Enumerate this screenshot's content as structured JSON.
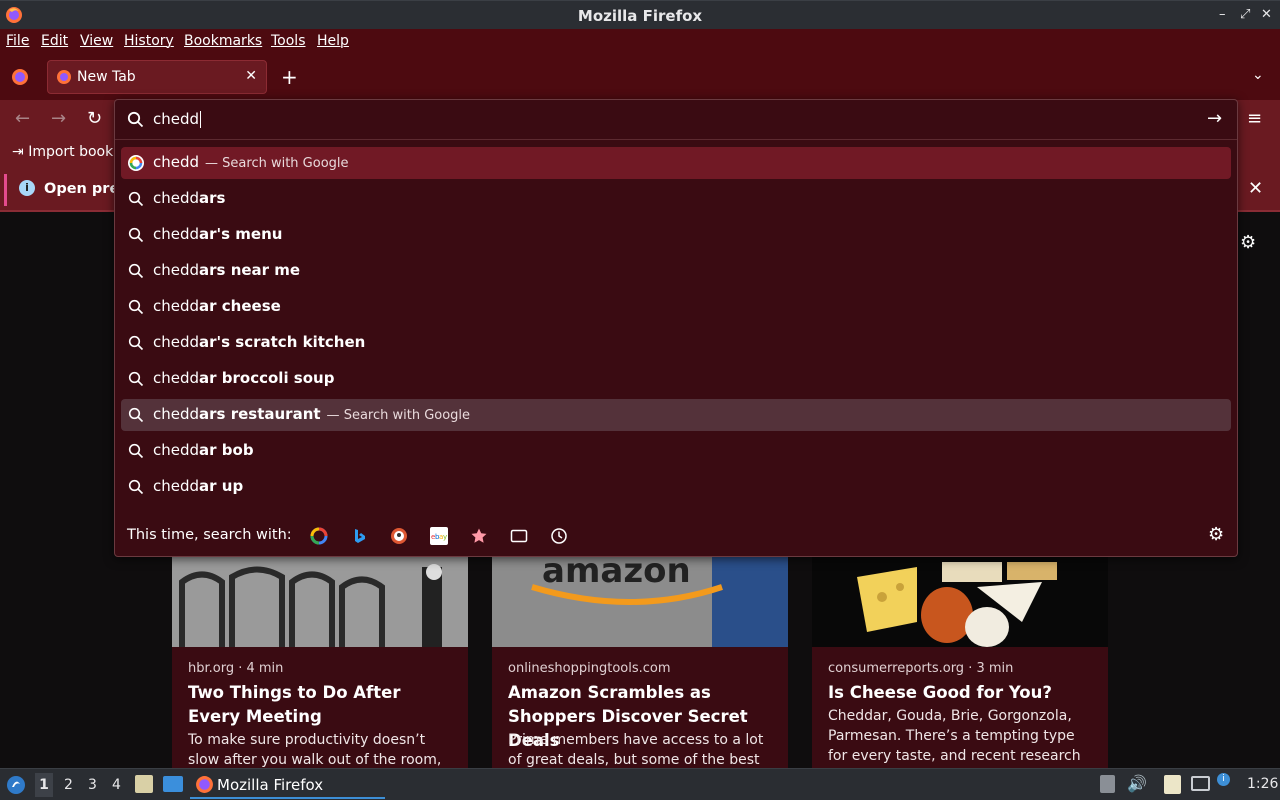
{
  "window": {
    "title": "Mozilla Firefox"
  },
  "menu": [
    "File",
    "Edit",
    "View",
    "History",
    "Bookmarks",
    "Tools",
    "Help"
  ],
  "tabs": [
    {
      "label": "New Tab"
    }
  ],
  "toolbar": {
    "bookmarks_import": "Import book",
    "notice_text": "Open pre"
  },
  "urlbar": {
    "value": "chedd",
    "suggestions": [
      {
        "typed": "chedd",
        "completion": "",
        "action": "Search with Google",
        "icon": "google-icon",
        "state": "selected"
      },
      {
        "typed": "chedd",
        "completion": "ars",
        "action": "",
        "icon": "search-icon",
        "state": ""
      },
      {
        "typed": "chedd",
        "completion": "ar's menu",
        "action": "",
        "icon": "search-icon",
        "state": ""
      },
      {
        "typed": "chedd",
        "completion": "ars near me",
        "action": "",
        "icon": "search-icon",
        "state": ""
      },
      {
        "typed": "chedd",
        "completion": "ar cheese",
        "action": "",
        "icon": "search-icon",
        "state": ""
      },
      {
        "typed": "chedd",
        "completion": "ar's scratch kitchen",
        "action": "",
        "icon": "search-icon",
        "state": ""
      },
      {
        "typed": "chedd",
        "completion": "ar broccoli soup",
        "action": "",
        "icon": "search-icon",
        "state": ""
      },
      {
        "typed": "chedd",
        "completion": "ars restaurant",
        "action": "Search with Google",
        "icon": "search-icon",
        "state": "hover"
      },
      {
        "typed": "chedd",
        "completion": "ar bob",
        "action": "",
        "icon": "search-icon",
        "state": ""
      },
      {
        "typed": "chedd",
        "completion": "ar up",
        "action": "",
        "icon": "search-icon",
        "state": ""
      }
    ],
    "engines_label": "This time, search with:",
    "engines": [
      "google-icon",
      "bing-icon",
      "duckduckgo-icon",
      "ebay-icon",
      "bookmarks-star-icon",
      "tabs-icon",
      "history-clock-icon"
    ]
  },
  "cards": [
    {
      "source": "hbr.org · 4 min",
      "headline": "Two Things to Do After Every Meeting",
      "excerpt": "To make sure productivity doesn’t slow after you walk out of the room, do two"
    },
    {
      "source": "onlineshoppingtools.com",
      "headline": "Amazon Scrambles as Shoppers Discover Secret Deals",
      "excerpt": "Prime members have access to a lot of great deals, but some of the best ones"
    },
    {
      "source": "consumerreports.org · 3 min",
      "headline": "Is Cheese Good for You?",
      "excerpt": "Cheddar, Gouda, Brie, Gorgonzola, Parmesan. There’s a tempting type for every taste, and recent research shows…"
    }
  ],
  "taskbar": {
    "workspaces": [
      "1",
      "2",
      "3",
      "4"
    ],
    "task_label": "Mozilla Firefox",
    "clock": "1:26"
  },
  "colors": {
    "frame": "#4d0a10",
    "toolbar": "#6a1a21",
    "popup": "#3a0b12",
    "selected": "#711925",
    "accent": "#3d8fd6"
  }
}
